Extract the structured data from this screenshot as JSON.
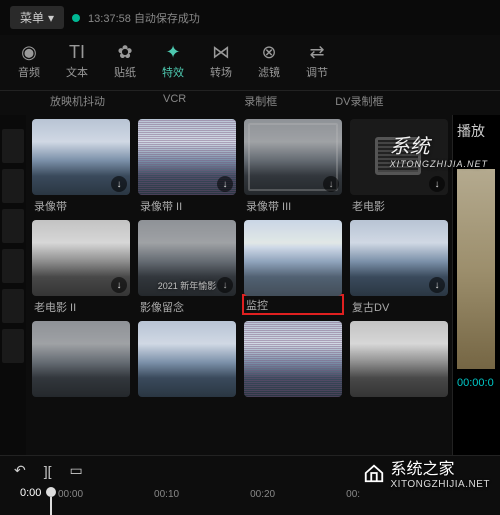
{
  "topbar": {
    "menu_label": "菜单",
    "timestamp": "13:37:58",
    "autosave": "自动保存成功"
  },
  "tabs": [
    {
      "icon": "◉",
      "label": "音频"
    },
    {
      "icon": "TI",
      "label": "文本"
    },
    {
      "icon": "✿",
      "label": "贴纸"
    },
    {
      "icon": "✦",
      "label": "特效"
    },
    {
      "icon": "⋈",
      "label": "转场"
    },
    {
      "icon": "⊗",
      "label": "滤镜"
    },
    {
      "icon": "⇄",
      "label": "调节"
    }
  ],
  "sub_labels": [
    "放映机抖动",
    "VCR",
    "录制框",
    "DV录制框"
  ],
  "effects": {
    "row1": [
      {
        "label": "录像带",
        "dl": true
      },
      {
        "label": "录像带 II",
        "dl": true
      },
      {
        "label": "录像带 III",
        "dl": true
      },
      {
        "label": "老电影",
        "dl": true
      }
    ],
    "row2": [
      {
        "label": "老电影 II",
        "dl": true
      },
      {
        "label": "影像留念",
        "dl": true,
        "year": "2021 新年愉影"
      },
      {
        "label": "监控",
        "dl": false,
        "highlight": true
      },
      {
        "label": "复古DV",
        "dl": true
      }
    ]
  },
  "preview": {
    "label": "播放",
    "timecode": "00:00:0"
  },
  "timeline": {
    "start": "0:00",
    "ticks": [
      "00:00",
      "00:10",
      "00:20",
      "00:"
    ]
  },
  "watermark": {
    "brand": "系统之家",
    "url_center": "XITONGZHIJIA.NET",
    "url_bottom": "XITONGZHIJIA.NET",
    "brand_center": "系统"
  }
}
